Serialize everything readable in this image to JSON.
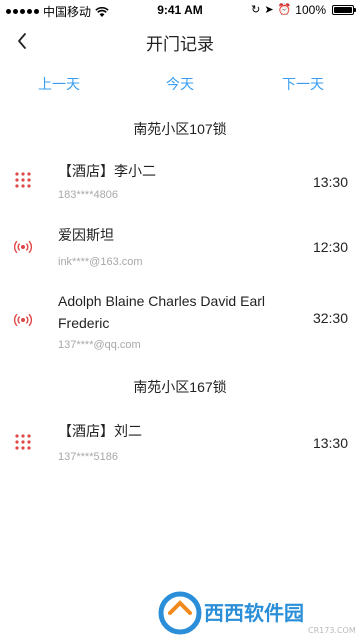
{
  "status_bar": {
    "carrier": "中国移动",
    "time": "9:41 AM",
    "battery_percent_label": "100%",
    "battery_level": 1.0
  },
  "nav": {
    "title": "开门记录"
  },
  "day_switcher": {
    "prev_label": "上一天",
    "today_label": "今天",
    "next_label": "下一天",
    "accent_color": "#3a9df0"
  },
  "groups": [
    {
      "title": "南苑小区107锁",
      "records": [
        {
          "icon": "keypad-icon",
          "name": "【酒店】李小二",
          "account": "183****4806",
          "time": "13:30"
        },
        {
          "icon": "wireless-signal-icon",
          "name": "爱因斯坦",
          "account": "ink****@163.com",
          "time": "12:30"
        },
        {
          "icon": "wireless-signal-icon",
          "name": "Adolph Blaine Charles David Earl Frederic",
          "account": "137****@qq.com",
          "time": "32:30"
        }
      ]
    },
    {
      "title": "南苑小区167锁",
      "records": [
        {
          "icon": "keypad-icon",
          "name": "【酒店】刘二",
          "account": "137****5186",
          "time": "13:30"
        }
      ]
    }
  ],
  "icon_color": "#e04848",
  "watermark": {
    "text": "西西软件园",
    "domain": "CR173.COM"
  }
}
